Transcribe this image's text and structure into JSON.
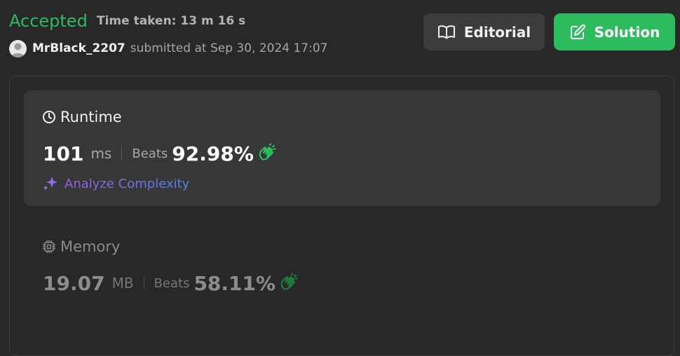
{
  "header": {
    "status": "Accepted",
    "time_taken": "Time taken: 13 m 16 s",
    "username": "MrBlack_2207",
    "submitted": "submitted at Sep 30, 2024 17:07"
  },
  "actions": {
    "editorial_label": "Editorial",
    "solution_label": "Solution"
  },
  "runtime": {
    "title": "Runtime",
    "value": "101",
    "unit": "ms",
    "beats_label": "Beats",
    "beats_pct": "92.98%",
    "analyze_label": "Analyze Complexity"
  },
  "memory": {
    "title": "Memory",
    "value": "19.07",
    "unit": "MB",
    "beats_label": "Beats",
    "beats_pct": "58.11%"
  },
  "colors": {
    "accepted_green": "#2cbb5d",
    "background": "#282828",
    "card": "#373737",
    "editorial_button": "#3c3c3c",
    "clap_active": "#2cbb5d",
    "clap_dim": "#1f7a3f"
  },
  "icons": {
    "avatar": "user-avatar",
    "editorial": "open-book-icon",
    "solution": "edit-icon",
    "runtime": "clock-icon",
    "memory": "chip-icon",
    "beats": "clapping-hands-icon",
    "analyze": "sparkle-icon"
  }
}
